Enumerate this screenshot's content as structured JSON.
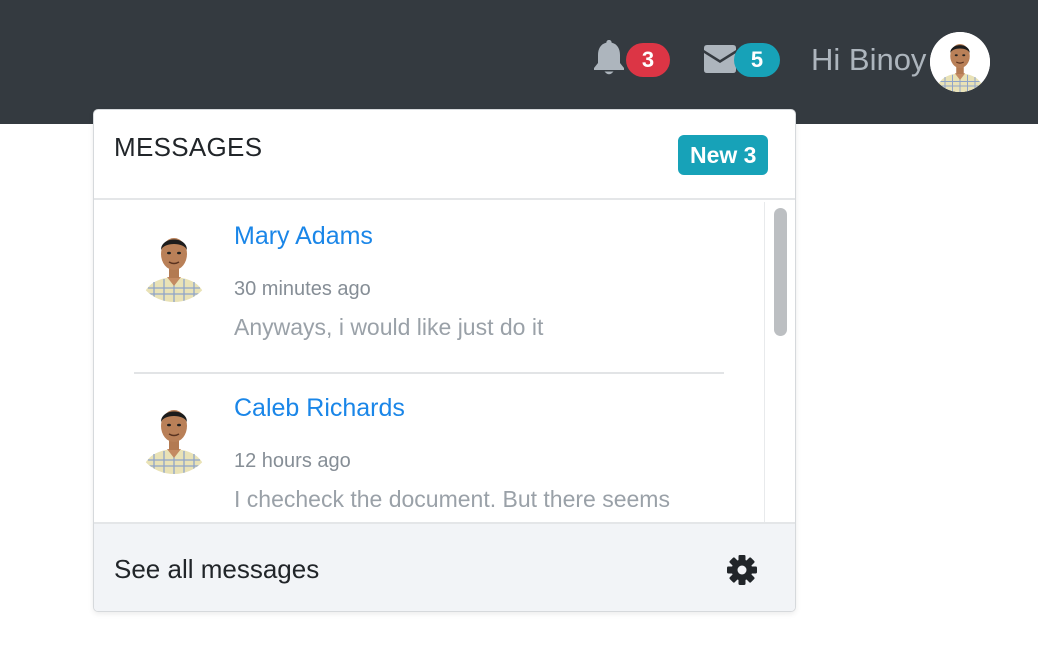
{
  "navbar": {
    "notifications": {
      "icon": "bell-icon",
      "count": "3",
      "badge_color": "#dc3545"
    },
    "messages": {
      "icon": "envelope-icon",
      "count": "5",
      "badge_color": "#17a2b8"
    },
    "greeting": "Hi Binoy"
  },
  "dropdown": {
    "title": "MESSAGES",
    "new_badge": "New 3",
    "items": [
      {
        "name": "Mary Adams",
        "time": "30 minutes ago",
        "text": "Anyways, i would like just do it"
      },
      {
        "name": "Caleb Richards",
        "time": "12 hours ago",
        "text": "I checheck the document. But there seems"
      }
    ],
    "footer": {
      "label": "See all messages",
      "icon": "gear-icon"
    }
  },
  "colors": {
    "navbar_bg": "#343a40",
    "link": "#1a86e8",
    "accent_teal": "#17a2b8",
    "danger": "#dc3545"
  }
}
